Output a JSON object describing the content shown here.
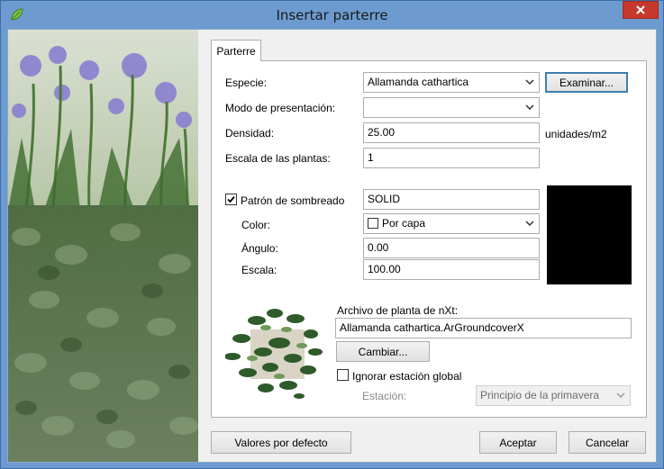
{
  "window": {
    "title": "Insertar parterre",
    "close_icon": "close-icon",
    "app_icon": "leaf-app-icon"
  },
  "tabs": [
    {
      "label": "Parterre"
    }
  ],
  "form": {
    "especie": {
      "label": "Especie:",
      "value": "Allamanda cathartica",
      "browse_button": "Examinar..."
    },
    "modo": {
      "label": "Modo de presentación:",
      "value": ""
    },
    "densidad": {
      "label": "Densidad:",
      "value": "25.00",
      "unit": "unidades/m2"
    },
    "escala_plantas": {
      "label": "Escala de las plantas:",
      "value": "1"
    },
    "sombreado": {
      "checkbox_label": "Patrón de sombreado",
      "checked": true,
      "pattern_value": "SOLID",
      "color": {
        "label": "Color:",
        "value": "Por capa",
        "swatch_color": "#ffffff"
      },
      "angulo": {
        "label": "Ángulo:",
        "value": "0.00"
      },
      "escala": {
        "label": "Escala:",
        "value": "100.00"
      },
      "preview_color": "#000000"
    },
    "archivo": {
      "label": "Archivo de planta de nXt:",
      "value": "Allamanda cathartica.ArGroundcoverX",
      "change_button": "Cambiar..."
    },
    "ignorar": {
      "label": "Ignorar estación global",
      "checked": false
    },
    "estacion": {
      "label": "Estación:",
      "value": "Principio de la primavera"
    }
  },
  "footer": {
    "defaults_button": "Valores por defecto",
    "ok_button": "Aceptar",
    "cancel_button": "Cancelar"
  },
  "colors": {
    "title_bar": "#6d9bd0",
    "close_button": "#c7382c",
    "dialog_bg": "#f0f0f0",
    "default_button_border": "#3c7fb1"
  }
}
